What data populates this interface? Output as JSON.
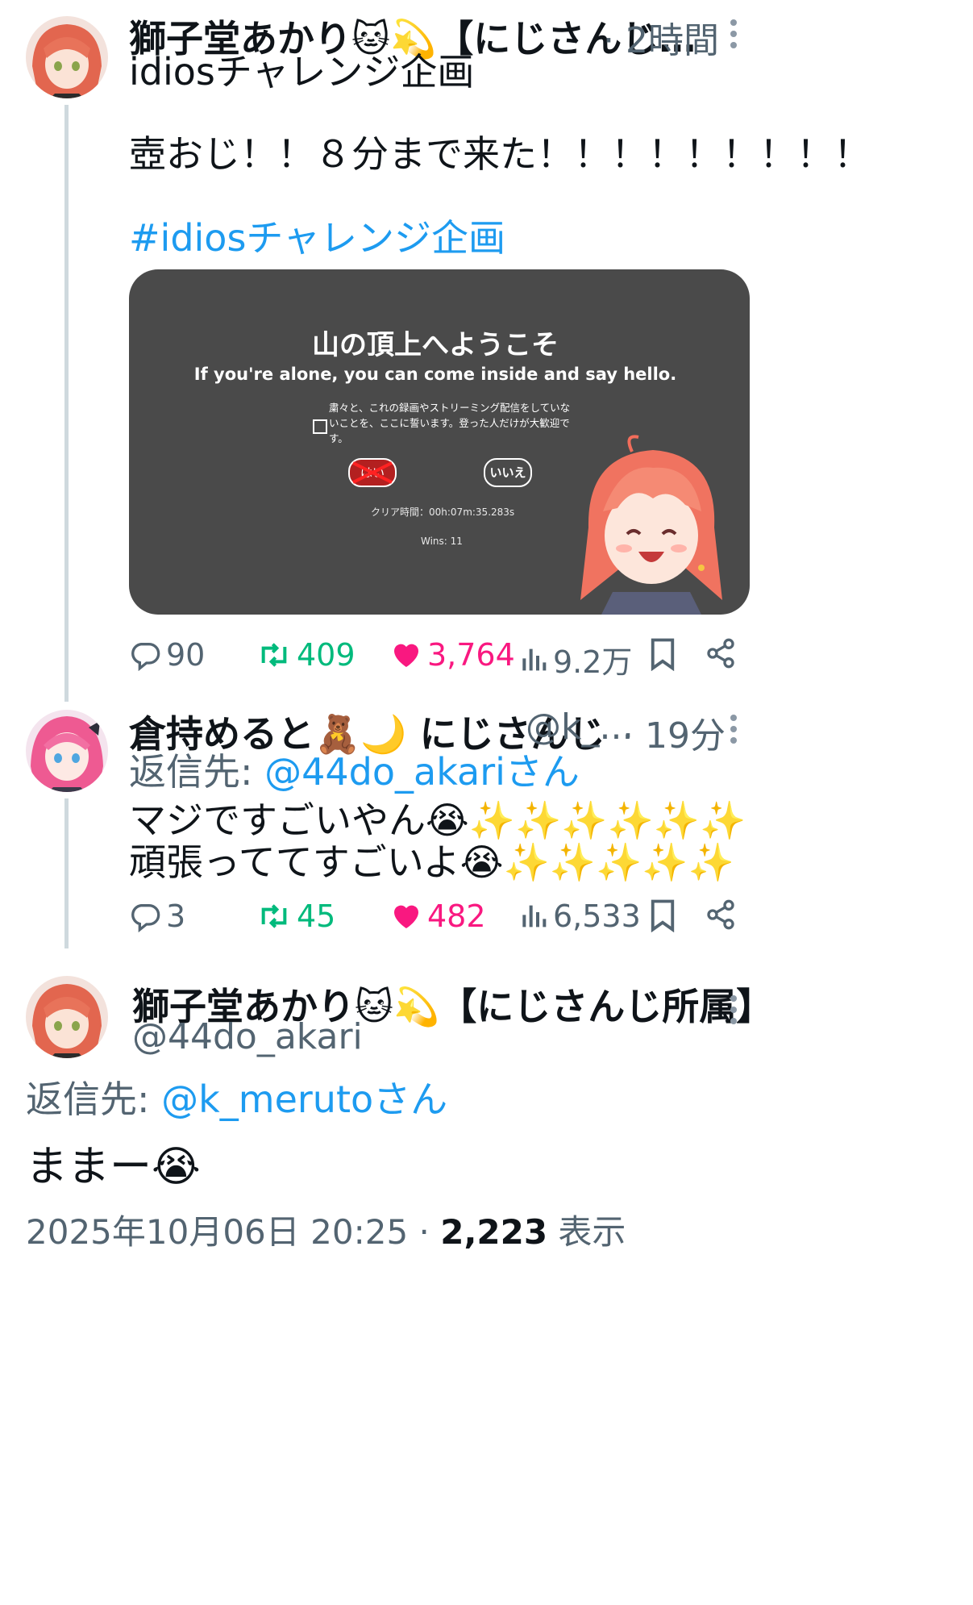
{
  "tweet1": {
    "author": "獅子堂あかり🐱💫【にじさんじ…",
    "time": "· 2時間",
    "line1": "idiosチャレンジ企画",
    "line2": "壺おじ！！８分まで来た！！！！！！！！！",
    "hashtag": "#idiosチャレンジ企画",
    "media": {
      "title": "山の頂上へようこそ",
      "subtitle": "If you're alone, you can come inside and say hello.",
      "pledge": "粛々と、これの録画やストリーミング配信をしていないことを、ここに誓います。登った人だけが大歓迎です。",
      "yes": "はい",
      "no": "いいえ",
      "clear_time": "クリア時間：00h:07m:35.283s",
      "wins": "Wins: 11"
    },
    "stats": {
      "replies": "90",
      "retweets": "409",
      "likes": "3,764",
      "views": "9.2万"
    }
  },
  "tweet2": {
    "author": "倉持めると🧸🌙 にじさんじ",
    "handle": "@k_...",
    "time": "· 19分",
    "reply_prefix": "返信先: ",
    "reply_to": "@44do_akariさん",
    "line1": "マジですごいやん😭✨✨✨✨✨✨",
    "line2": "頑張っててすごいよ😭✨✨✨✨✨",
    "stats": {
      "replies": "3",
      "retweets": "45",
      "likes": "482",
      "views": "6,533"
    }
  },
  "tweet3": {
    "author": "獅子堂あかり🐱💫【にじさんじ所属】",
    "handle": "@44do_akari",
    "reply_prefix": "返信先: ",
    "reply_to": "@k_merutoさん",
    "body": "ままー😭",
    "timestamp": "2025年10月06日 20:25 · ",
    "views_count": "2,223",
    "views_label": " 表示"
  },
  "colors": {
    "link": "#1d9bf0",
    "retweet": "#00ba7c",
    "like": "#f91880",
    "meta": "#536471",
    "media_bg": "#4a4a4a"
  }
}
